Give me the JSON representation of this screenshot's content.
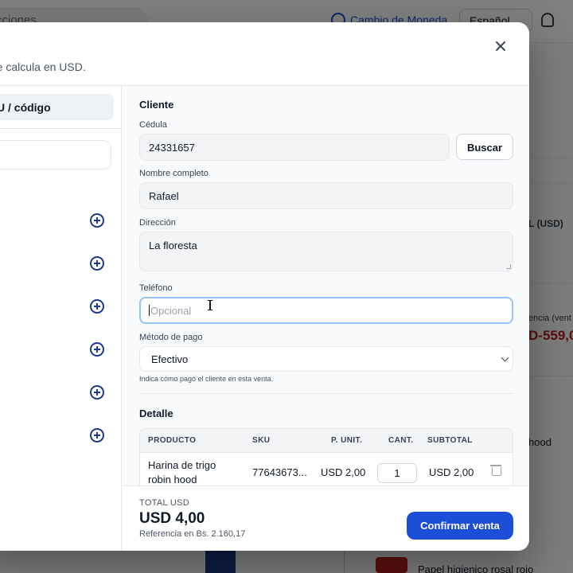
{
  "background": {
    "search_placeholder": "cciones",
    "currency_label": "Cambio de Moneda",
    "language": "Español",
    "right_panel": {
      "column_label": "L (USD)",
      "reference_label": "encia (vent",
      "reference_value": "D-559,0",
      "product_1": "hood",
      "product_2": "Papel higienico rosal rojo"
    }
  },
  "modal": {
    "subtitle": "tal se calcula en USD.",
    "left": {
      "active_tab": "U / código"
    },
    "cliente": {
      "title": "Cliente",
      "cedula_label": "Cédula",
      "cedula_value": "24331657",
      "buscar_label": "Buscar",
      "nombre_label": "Nombre completo",
      "nombre_value": "Rafael",
      "direccion_label": "Dirección",
      "direccion_value": "La floresta",
      "telefono_label": "Teléfono",
      "telefono_placeholder": "Opcional",
      "metodo_label": "Método de pago",
      "metodo_value": "Efectivo",
      "metodo_hint": "Indica cómo pagó el cliente en esta venta."
    },
    "detalle": {
      "title": "Detalle",
      "columns": [
        "PRODUCTO",
        "SKU",
        "P. UNIT.",
        "CANT.",
        "SUBTOTAL"
      ],
      "rows": [
        {
          "producto_line1": "Harina de trigo",
          "producto_line2": "robin hood",
          "sku": "77643673...",
          "precio": "USD 2,00",
          "cantidad": "1",
          "subtotal": "USD 2,00"
        }
      ]
    },
    "footer": {
      "total_label": "TOTAL USD",
      "total_value": "USD 4,00",
      "reference": "Referencia en Bs. 2.160,17",
      "confirm_label": "Confirmar venta"
    }
  },
  "colors": {
    "accent": "#1d4ed8",
    "icon_navy": "#1e3a8a",
    "overlay": "rgba(0,0,0,0.5)"
  }
}
